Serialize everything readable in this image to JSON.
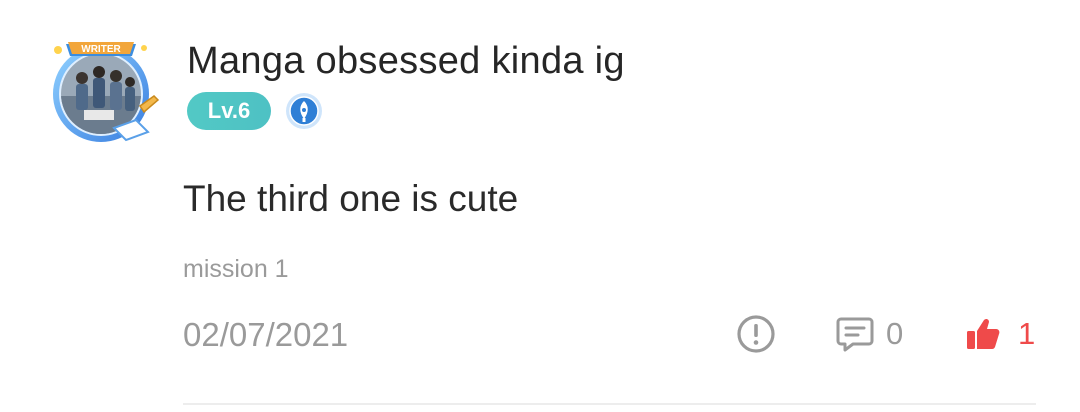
{
  "comment": {
    "author": "Manga obsessed kinda ig",
    "avatar_frame_label": "WRITER",
    "level_badge": "Lv.6",
    "body": "The third one is cute",
    "tag": "mission 1",
    "date": "02/07/2021",
    "reply_count": "0",
    "like_count": "1"
  },
  "icons": {
    "writer_badge": "quill-pen-badge-icon",
    "report": "exclamation-circle-icon",
    "reply": "comment-bubble-icon",
    "like": "thumbs-up-icon"
  },
  "colors": {
    "level_badge": "#52c9c5",
    "writer_badge": "#2f7fd6",
    "like": "#ef4a4a",
    "muted_text": "#9a9a9a",
    "primary_text": "#262626"
  }
}
